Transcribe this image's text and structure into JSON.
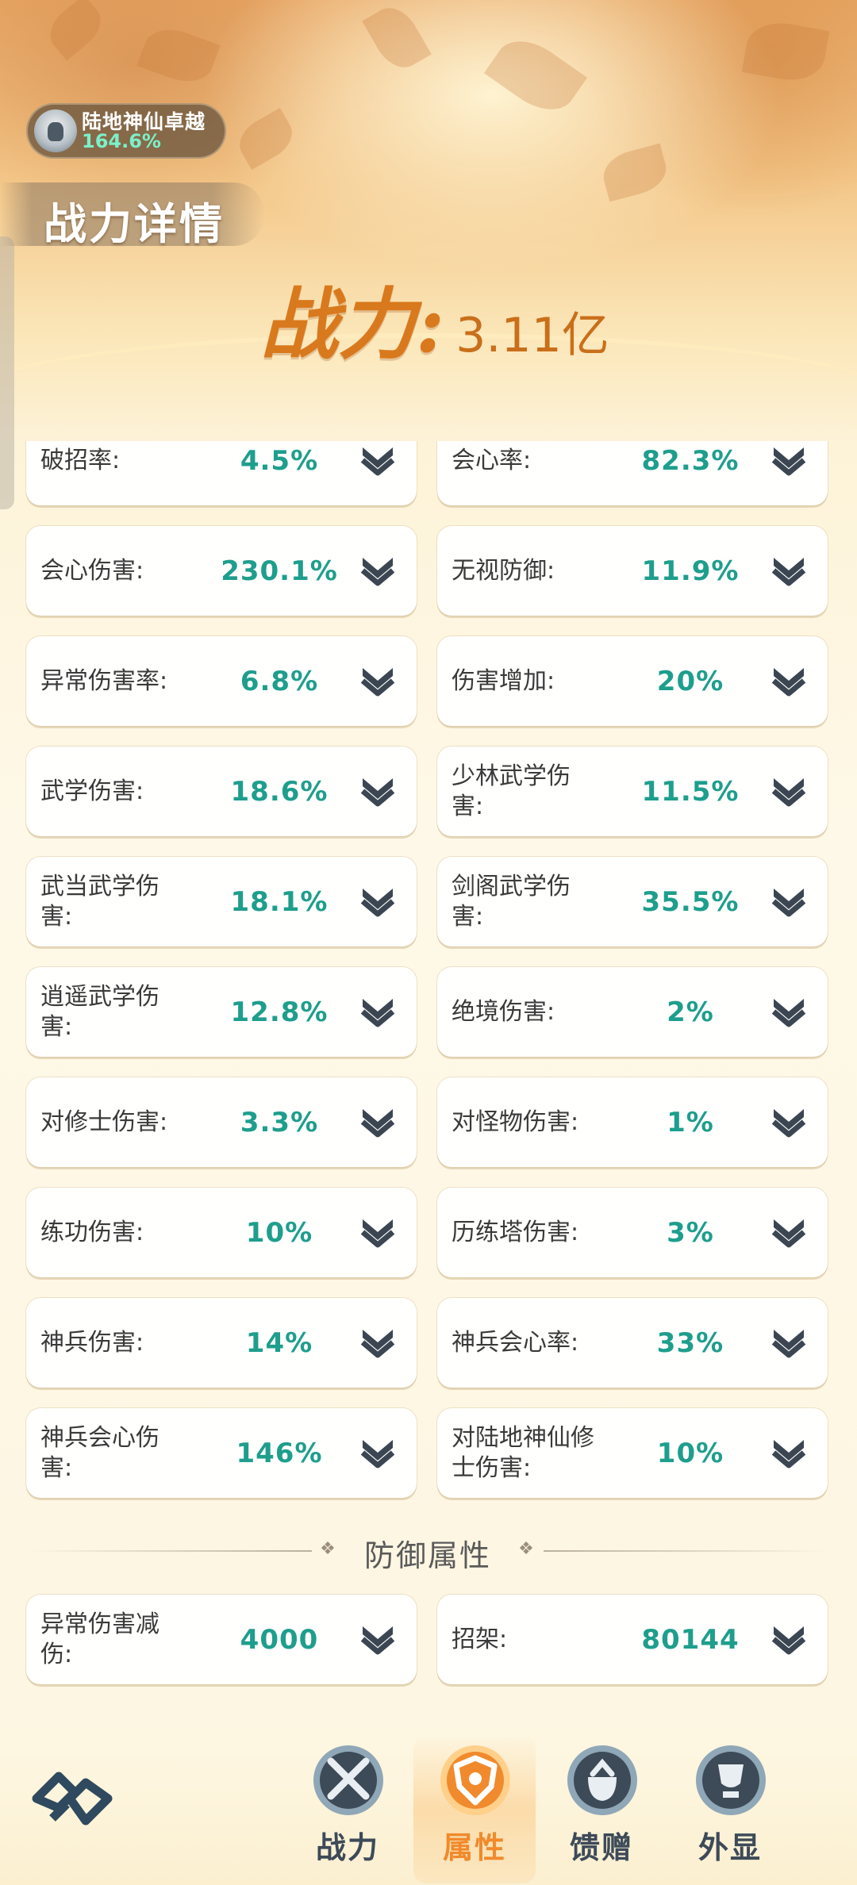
{
  "realm": {
    "name": "陆地神仙卓越",
    "percent": "164.6%"
  },
  "page_title": "战力详情",
  "power": {
    "label": "战力:",
    "value": "3.11亿"
  },
  "stats": [
    {
      "left": {
        "label": "破招率:",
        "value": "4.5%"
      },
      "right": {
        "label": "会心率:",
        "value": "82.3%"
      }
    },
    {
      "left": {
        "label": "会心伤害:",
        "value": "230.1%"
      },
      "right": {
        "label": "无视防御:",
        "value": "11.9%"
      }
    },
    {
      "left": {
        "label": "异常伤害率:",
        "value": "6.8%"
      },
      "right": {
        "label": "伤害增加:",
        "value": "20%"
      }
    },
    {
      "left": {
        "label": "武学伤害:",
        "value": "18.6%"
      },
      "right": {
        "label": "少林武学伤害:",
        "value": "11.5%"
      }
    },
    {
      "left": {
        "label": "武当武学伤害:",
        "value": "18.1%"
      },
      "right": {
        "label": "剑阁武学伤害:",
        "value": "35.5%"
      }
    },
    {
      "left": {
        "label": "逍遥武学伤害:",
        "value": "12.8%"
      },
      "right": {
        "label": "绝境伤害:",
        "value": "2%"
      }
    },
    {
      "left": {
        "label": "对修士伤害:",
        "value": "3.3%"
      },
      "right": {
        "label": "对怪物伤害:",
        "value": "1%"
      }
    },
    {
      "left": {
        "label": "练功伤害:",
        "value": "10%"
      },
      "right": {
        "label": "历练塔伤害:",
        "value": "3%"
      }
    },
    {
      "left": {
        "label": "神兵伤害:",
        "value": "14%"
      },
      "right": {
        "label": "神兵会心率:",
        "value": "33%"
      }
    },
    {
      "left": {
        "label": "神兵会心伤害:",
        "value": "146%"
      },
      "right": {
        "label": "对陆地神仙修士伤害:",
        "value": "10%"
      }
    }
  ],
  "defense_section": {
    "title": "防御属性",
    "stats": [
      {
        "left": {
          "label": "异常伤害减伤:",
          "value": "4000"
        },
        "right": {
          "label": "招架:",
          "value": "80144"
        }
      }
    ]
  },
  "nav": {
    "tabs": [
      {
        "label": "战力",
        "icon": "swords-icon",
        "active": false
      },
      {
        "label": "属性",
        "icon": "shield-icon",
        "active": true
      },
      {
        "label": "馈赠",
        "icon": "gift-bag-icon",
        "active": false
      },
      {
        "label": "外显",
        "icon": "trophy-icon",
        "active": false
      }
    ]
  },
  "colors": {
    "accent": "#d9791d",
    "value": "#1e9e8c",
    "active_tab": "#f08a2c",
    "icon_dark": "#3d4a58"
  }
}
